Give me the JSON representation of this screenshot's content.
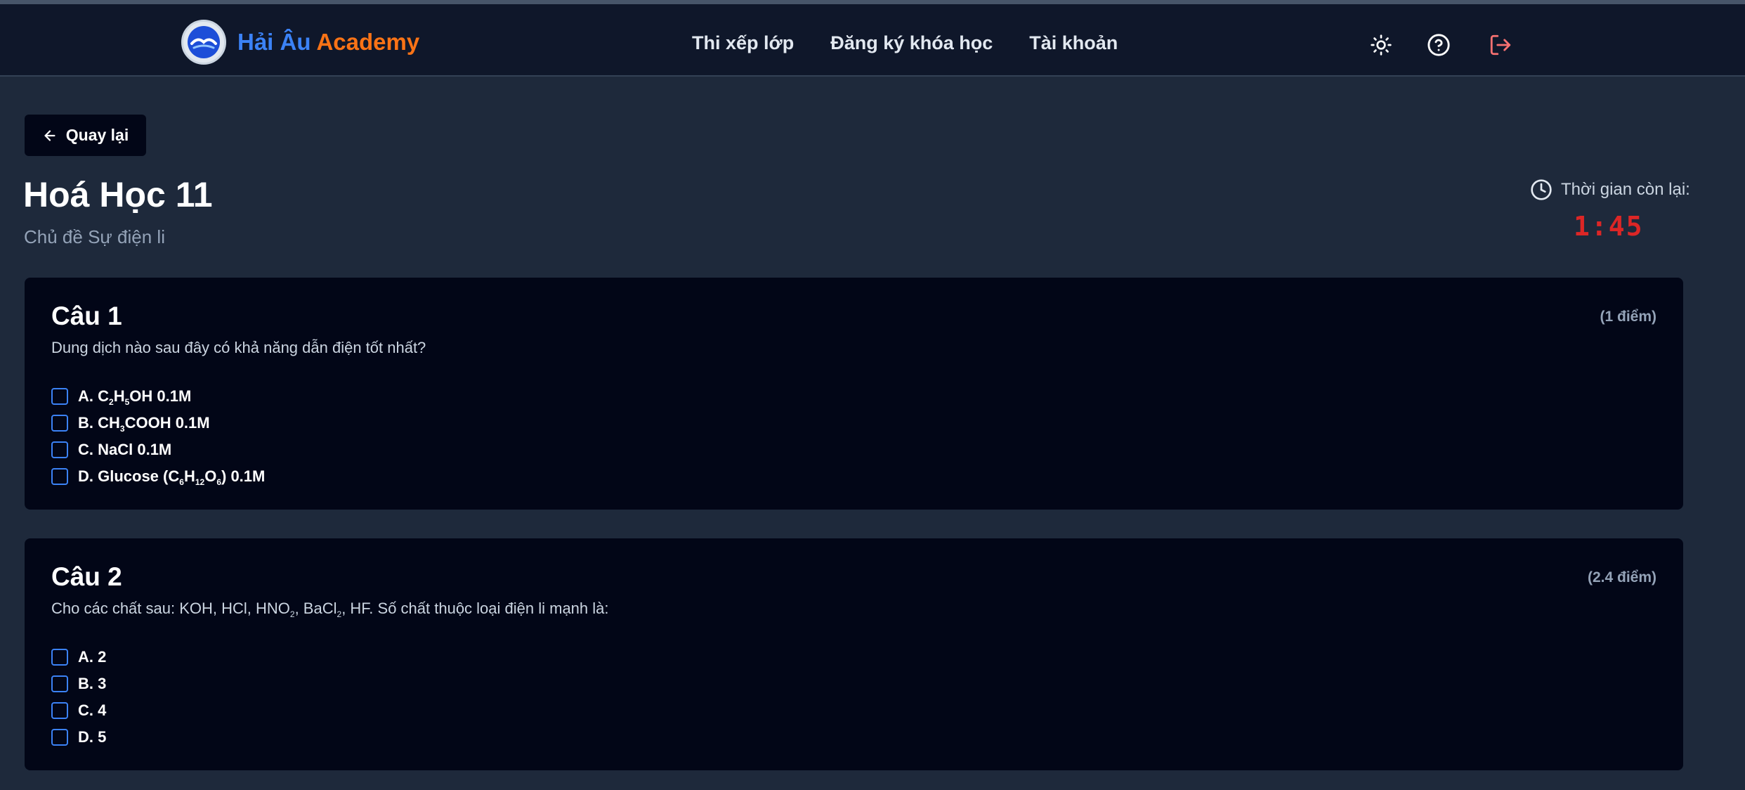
{
  "brand": {
    "name_part1": "Hải Âu",
    "name_part2": "Academy",
    "logo_icon": "seagull-logo",
    "color_part1": "#3b82f6",
    "color_part2": "#f97316"
  },
  "nav": [
    {
      "label": "Thi xếp lớp"
    },
    {
      "label": "Đăng ký khóa học"
    },
    {
      "label": "Tài khoản"
    }
  ],
  "header_icons": [
    "sun-icon",
    "help-icon",
    "logout-icon"
  ],
  "back_button": {
    "label": "Quay lại",
    "icon": "arrow-left-icon"
  },
  "page": {
    "title": "Hoá Học 11",
    "subtitle": "Chủ đề Sự điện li"
  },
  "timer": {
    "label": "Thời gian còn lại:",
    "value": "1:45",
    "color": "#dc2626",
    "icon": "clock-icon"
  },
  "questions": [
    {
      "heading": "Câu 1",
      "points": "(1 điểm)",
      "text": "Dung dịch nào sau đây có khả năng dẫn điện tốt nhất?",
      "options": [
        {
          "prefix": "A. C",
          "s1": "2",
          "m1": "H",
          "s2": "5",
          "m2": "OH 0.1M"
        },
        {
          "prefix": "B. CH",
          "s1": "3",
          "m1": "COOH 0.1M"
        },
        {
          "prefix": "C. NaCl 0.1M"
        },
        {
          "prefix": "D. Glucose (C",
          "s1": "6",
          "m1": "H",
          "s2": "12",
          "m2": "O",
          "s3": "6",
          "m3": ") 0.1M"
        }
      ]
    },
    {
      "heading": "Câu 2",
      "points": "(2.4 điểm)",
      "text_parts": {
        "t1": "Cho các chất sau: KOH, HCl, HNO",
        "s1": "2",
        "t2": ", BaCl",
        "s2": "2",
        "t3": ", HF. Số chất thuộc loại điện li mạnh là:"
      },
      "options": [
        {
          "label": "A. 2"
        },
        {
          "label": "B. 3"
        },
        {
          "label": "C. 4"
        },
        {
          "label": "D. 5"
        }
      ]
    }
  ]
}
